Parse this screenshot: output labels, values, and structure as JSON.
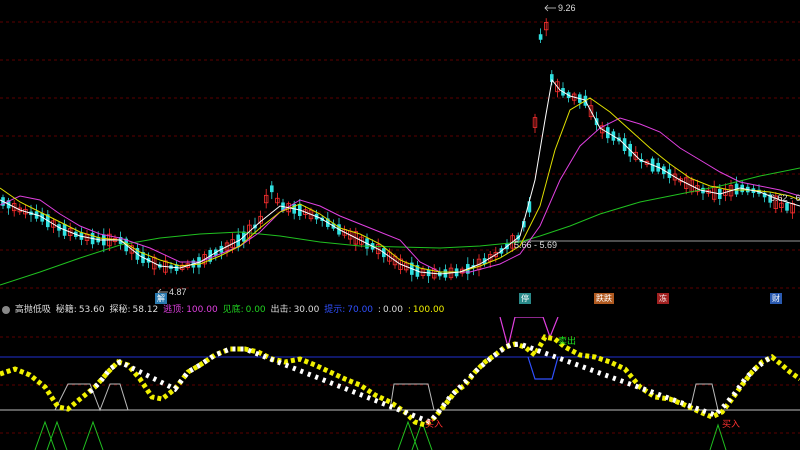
{
  "main_chart": {
    "price_labels": {
      "high": "9.26",
      "low": "4.87",
      "range": "5.66 - 5.69",
      "right": "6.62 - 6"
    },
    "event_tags": [
      {
        "label": "解",
        "color": "#3aa0d0"
      },
      {
        "label": "停",
        "color": "#3aa0a0"
      },
      {
        "label": "跌跌",
        "color": "#c06020"
      },
      {
        "label": "冻",
        "color": "#b02020"
      },
      {
        "label": "财",
        "color": "#3070c0"
      }
    ]
  },
  "indicator_bar": {
    "name": "高抛低吸",
    "items": [
      {
        "label": "秘籍:",
        "value": "53.60",
        "color": "#dddddd"
      },
      {
        "label": "探秘:",
        "value": "58.12",
        "color": "#dddddd"
      },
      {
        "label": "逃顶:",
        "value": "100.00",
        "color": "#e040e0"
      },
      {
        "label": "见底:",
        "value": "0.00",
        "color": "#20d020"
      },
      {
        "label": "出击:",
        "value": "30.00",
        "color": "#dddddd"
      },
      {
        "label": "提示:",
        "value": "70.00",
        "color": "#3050ff"
      },
      {
        "label": ":",
        "value": "0.00",
        "color": "#dddddd"
      },
      {
        "label": ":",
        "value": "100.00",
        "color": "#f0f000"
      }
    ]
  },
  "sub_chart": {
    "labels": {
      "sell": "卖出",
      "buy_left": "买入",
      "buy_right": "买入"
    }
  },
  "colors": {
    "up": "#ff3030",
    "down": "#30e0e0",
    "ma5": "#ffffff",
    "ma10": "#e0e000",
    "ma20": "#e040e0",
    "ma60": "#20c020",
    "grid": "#8b0000"
  }
}
